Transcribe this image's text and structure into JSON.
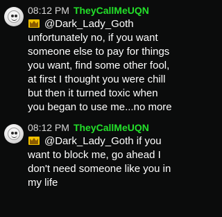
{
  "messages": [
    {
      "time": "08:12 PM",
      "username": "TheyCallMeUQN",
      "badge_icon": "crown-icon",
      "text": "@Dark_Lady_Goth unfortunately no, if you want someone else to pay for things you want, find some other fool, at first I thought you were chill but then it turned toxic when you began to use me...no more"
    },
    {
      "time": "08:12 PM",
      "username": "TheyCallMeUQN",
      "badge_icon": "crown-icon",
      "text": "@Dark_Lady_Goth if you want to block me, go ahead I don't need someone like you in my life"
    }
  ],
  "colors": {
    "background": "#0b0c0c",
    "username": "#23e02a",
    "timestamp": "#d8d8d8",
    "message_text": "#ffffff",
    "badge": "#f2c200"
  }
}
